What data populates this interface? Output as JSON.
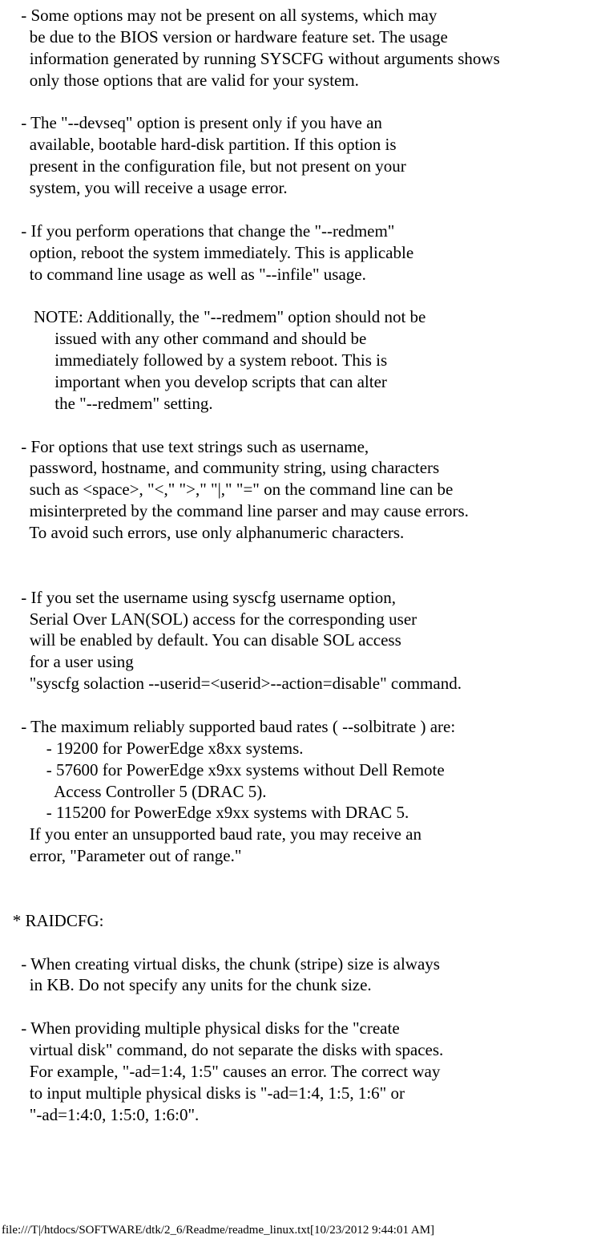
{
  "lines": [
    "     - Some options may not be present on all systems, which may",
    "       be due to the BIOS version or hardware feature set. The usage",
    "       information generated by running SYSCFG without arguments shows",
    "       only those options that are valid for your system.",
    "",
    "     - The \"--devseq\" option is present only if you have an",
    "       available, bootable hard-disk partition. If this option is",
    "       present in the configuration file, but not present on your",
    "       system, you will receive a usage error.",
    "",
    "     - If you perform operations that change the \"--redmem\"",
    "       option, reboot the system immediately. This is applicable",
    "       to command line usage as well as \"--infile\" usage.",
    "",
    "        NOTE: Additionally, the \"--redmem\" option should not be",
    "             issued with any other command and should be",
    "             immediately followed by a system reboot. This is",
    "             important when you develop scripts that can alter",
    "             the \"--redmem\" setting.",
    "",
    "     - For options that use text strings such as username,",
    "       password, hostname, and community string, using characters",
    "       such as <space>, \"<,\" \">,\" \"|,\" \"=\" on the command line can be",
    "       misinterpreted by the command line parser and may cause errors.",
    "       To avoid such errors, use only alphanumeric characters.",
    "",
    "",
    "     - If you set the username using syscfg username option,",
    "       Serial Over LAN(SOL) access for the corresponding user",
    "       will be enabled by default. You can disable SOL access",
    "       for a user using",
    "       \"syscfg solaction --userid=<userid>--action=disable\" command.",
    "",
    "     - The maximum reliably supported baud rates ( --solbitrate ) are:",
    "           - 19200 for PowerEdge x8xx systems.",
    "           - 57600 for PowerEdge x9xx systems without Dell Remote",
    "             Access Controller 5 (DRAC 5).",
    "           - 115200 for PowerEdge x9xx systems with DRAC 5.",
    "       If you enter an unsupported baud rate, you may receive an",
    "       error, \"Parameter out of range.\"",
    "",
    "",
    "   * RAIDCFG:",
    "",
    "     - When creating virtual disks, the chunk (stripe) size is always",
    "       in KB. Do not specify any units for the chunk size.",
    "",
    "     - When providing multiple physical disks for the \"create",
    "       virtual disk\" command, do not separate the disks with spaces.",
    "       For example, \"-ad=1:4, 1:5\" causes an error. The correct way",
    "       to input multiple physical disks is \"-ad=1:4, 1:5, 1:6\" or",
    "       \"-ad=1:4:0, 1:5:0, 1:6:0\"."
  ],
  "footer": "file:///T|/htdocs/SOFTWARE/dtk/2_6/Readme/readme_linux.txt[10/23/2012 9:44:01 AM]"
}
